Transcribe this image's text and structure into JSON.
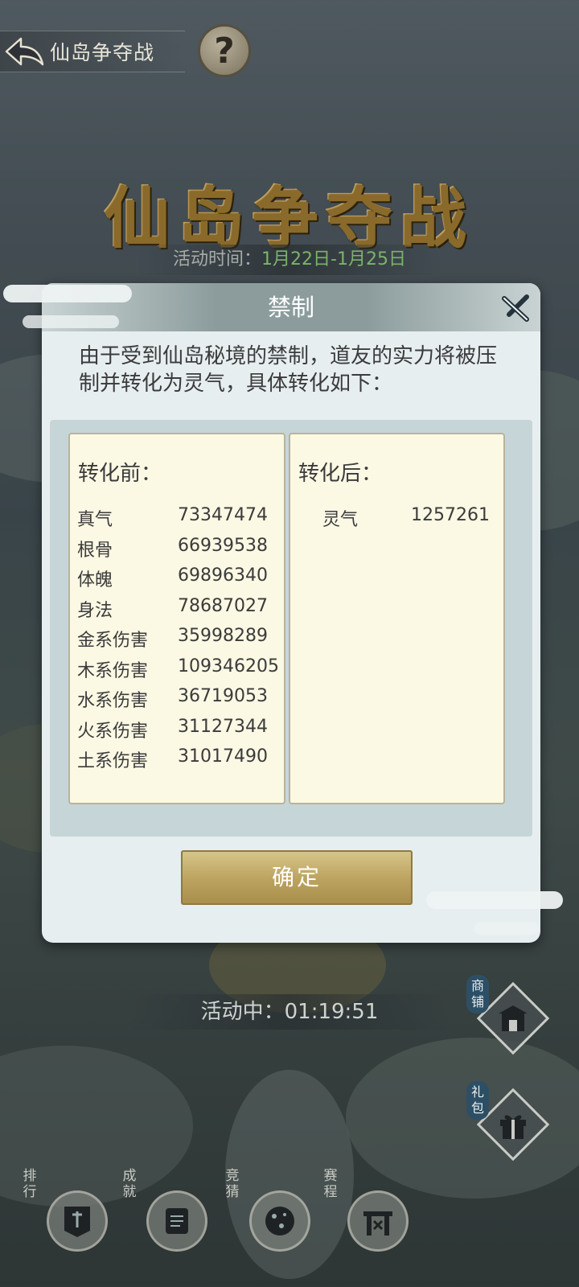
{
  "topbar": {
    "title": "仙岛争夺战",
    "help_symbol": "?"
  },
  "banner": {
    "title": "仙岛争夺战",
    "time_label": "活动时间：",
    "time_value": "1月22日-1月25日"
  },
  "modal": {
    "title": "禁制",
    "intro": "由于受到仙岛秘境的禁制，道友的实力将被压制并转化为灵气，具体转化如下：",
    "before_title": "转化前：",
    "after_title": "转化后：",
    "before_rows": [
      {
        "name": "真气",
        "value": "73347474"
      },
      {
        "name": "根骨",
        "value": "66939538"
      },
      {
        "name": "体魄",
        "value": "69896340"
      },
      {
        "name": "身法",
        "value": "78687027"
      },
      {
        "name": "金系伤害",
        "value": "35998289"
      },
      {
        "name": "木系伤害",
        "value": "109346205"
      },
      {
        "name": "水系伤害",
        "value": "36719053"
      },
      {
        "name": "火系伤害",
        "value": "31127344"
      },
      {
        "name": "土系伤害",
        "value": "31017490"
      }
    ],
    "after_rows": [
      {
        "name": "灵气",
        "value": "1257261"
      }
    ],
    "confirm_label": "确定"
  },
  "status": {
    "text": "活动中：01:19:51"
  },
  "side_buttons": [
    {
      "label": "商铺",
      "icon": "shop-icon"
    },
    {
      "label": "礼包",
      "icon": "gift-icon"
    }
  ],
  "bottom_buttons": [
    {
      "label": "排行",
      "icon": "banner-icon"
    },
    {
      "label": "成就",
      "icon": "scroll-icon"
    },
    {
      "label": "竞猜",
      "icon": "orb-icon"
    },
    {
      "label": "赛程",
      "icon": "gate-icon"
    }
  ]
}
